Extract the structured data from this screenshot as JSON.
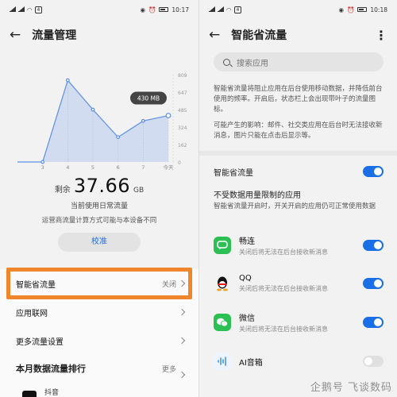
{
  "left": {
    "status": {
      "time": "10:17",
      "badge": "4"
    },
    "title": "流量管理",
    "chart_data": {
      "type": "area",
      "x": [
        "",
        "3",
        "4",
        "5",
        "6",
        "7",
        "今天"
      ],
      "values": [
        0,
        0,
        757,
        485,
        230,
        380,
        430
      ],
      "yticks": [
        "809",
        "647",
        "485",
        "324",
        "162",
        "0"
      ],
      "ylim": [
        0,
        809
      ],
      "tooltip": "430 MB",
      "color": "#5b8fe8"
    },
    "summary": {
      "remain_label": "剩余",
      "remain_value": "37.66",
      "remain_unit": "GB",
      "plan_text": "当前使用日常流量",
      "note_text": "运营商流量计算方式可能与本设备不同",
      "calibrate_label": "校准"
    },
    "list": [
      {
        "label": "智能省流量",
        "value": "关闭"
      },
      {
        "label": "应用联网",
        "value": ""
      },
      {
        "label": "更多流量设置",
        "value": ""
      }
    ],
    "ranking": {
      "title": "本月数据流量排行",
      "more": "更多",
      "first_app": "抖音"
    },
    "highlight_color": "#f0862c"
  },
  "right": {
    "status": {
      "time": "10:18",
      "badge": "4"
    },
    "title": "智能省流量",
    "search_placeholder": "搜索应用",
    "desc1": "智能省流量将阻止应用在后台使用移动数据，并降低前台使用的频率。开启后，状态栏上会出现带叶子的流量图标。",
    "desc2": "可能产生的影响：邮件、社交类应用在后台时无法接收新消息，图片只能在点击后显示等。",
    "master_label": "智能省流量",
    "unrestricted_title": "不受数据用量限制的应用",
    "unrestricted_desc": "智能省流量开启时，开关开启的应用仍可正常使用数据",
    "apps": [
      {
        "name": "畅连",
        "sub": "关闭后将无法在后台接收新消息",
        "on": true,
        "icon": "changlian-icon",
        "color": "#2bbf54"
      },
      {
        "name": "QQ",
        "sub": "关闭后将无法在后台接收新消息",
        "on": true,
        "icon": "qq-icon",
        "color": "#111111"
      },
      {
        "name": "微信",
        "sub": "关闭后将无法在后台接收新消息",
        "on": true,
        "icon": "wechat-icon",
        "color": "#2bbf54"
      },
      {
        "name": "AI音箱",
        "sub": "",
        "on": false,
        "icon": "ai-speaker-icon",
        "color": "#3a8ee6"
      }
    ],
    "accent": "#1a6ee6"
  },
  "watermark": "企鹅号 飞谈数码"
}
